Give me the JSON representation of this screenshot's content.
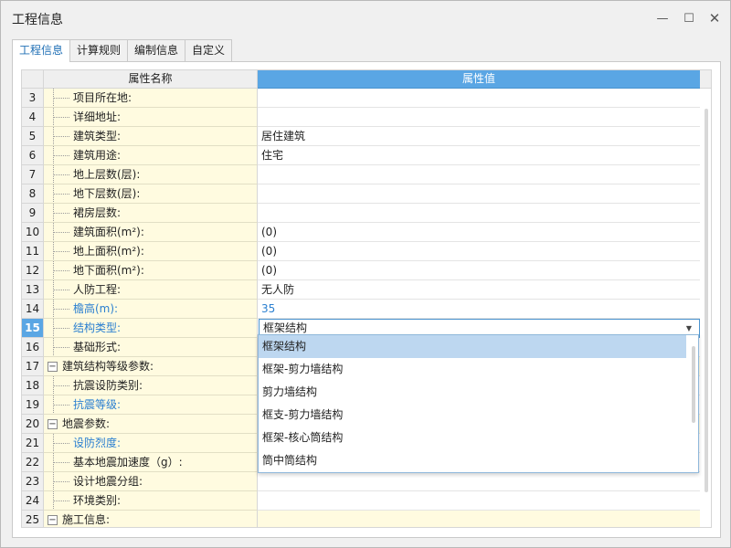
{
  "window": {
    "title": "工程信息",
    "minimize_glyph": "—",
    "maximize_glyph": "☐",
    "close_glyph": "✕"
  },
  "tabs": [
    {
      "label": "工程信息",
      "active": true
    },
    {
      "label": "计算规则",
      "active": false
    },
    {
      "label": "编制信息",
      "active": false
    },
    {
      "label": "自定义",
      "active": false
    }
  ],
  "grid": {
    "header_name": "属性名称",
    "header_value": "属性值",
    "rows": [
      {
        "idx": "3",
        "name": "项目所在地:",
        "value": ""
      },
      {
        "idx": "4",
        "name": "详细地址:",
        "value": ""
      },
      {
        "idx": "5",
        "name": "建筑类型:",
        "value": "居住建筑"
      },
      {
        "idx": "6",
        "name": "建筑用途:",
        "value": "住宅"
      },
      {
        "idx": "7",
        "name": "地上层数(层):",
        "value": ""
      },
      {
        "idx": "8",
        "name": "地下层数(层):",
        "value": ""
      },
      {
        "idx": "9",
        "name": "裙房层数:",
        "value": ""
      },
      {
        "idx": "10",
        "name": "建筑面积(m²):",
        "value": "(0)"
      },
      {
        "idx": "11",
        "name": "地上面积(m²):",
        "value": "(0)"
      },
      {
        "idx": "12",
        "name": "地下面积(m²):",
        "value": "(0)"
      },
      {
        "idx": "13",
        "name": "人防工程:",
        "value": "无人防"
      },
      {
        "idx": "14",
        "name": "檐高(m):",
        "value": "35"
      },
      {
        "idx": "15",
        "name": "结构类型:",
        "value": "框架结构"
      },
      {
        "idx": "16",
        "name": "基础形式:",
        "value": ""
      },
      {
        "idx": "17",
        "name": "建筑结构等级参数:",
        "value": ""
      },
      {
        "idx": "18",
        "name": "抗震设防类别:",
        "value": ""
      },
      {
        "idx": "19",
        "name": "抗震等级:",
        "value": ""
      },
      {
        "idx": "20",
        "name": "地震参数:",
        "value": ""
      },
      {
        "idx": "21",
        "name": "设防烈度:",
        "value": ""
      },
      {
        "idx": "22",
        "name": "基本地震加速度（g）:",
        "value": ""
      },
      {
        "idx": "23",
        "name": "设计地震分组:",
        "value": ""
      },
      {
        "idx": "24",
        "name": "环境类别:",
        "value": ""
      },
      {
        "idx": "25",
        "name": "施工信息:",
        "value": ""
      }
    ],
    "expander_glyph": "−",
    "dropdown_arrow_glyph": "▼"
  },
  "dropdown": {
    "options": [
      "框架结构",
      "框架-剪力墙结构",
      "剪力墙结构",
      "框支-剪力墙结构",
      "框架-核心筒结构",
      "筒中筒结构"
    ]
  }
}
